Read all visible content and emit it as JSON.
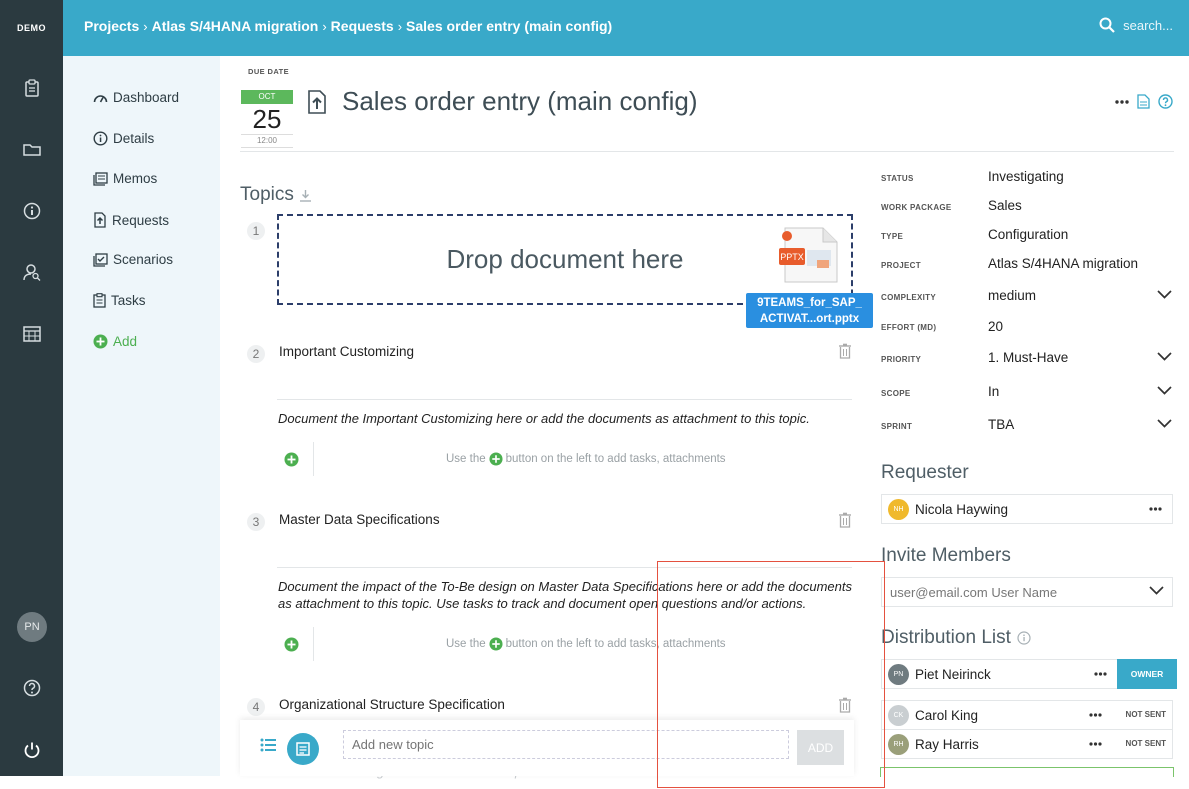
{
  "brand": "DEMO",
  "breadcrumbs": [
    "Projects",
    "Atlas S/4HANA migration",
    "Requests",
    "Sales order entry (main config)"
  ],
  "search_placeholder": "search...",
  "user_initials": "PN",
  "nav": [
    {
      "label": "Dashboard",
      "icon": "gauge-icon"
    },
    {
      "label": "Details",
      "icon": "info-icon"
    },
    {
      "label": "Memos",
      "icon": "memo-icon"
    },
    {
      "label": "Requests",
      "icon": "request-icon"
    },
    {
      "label": "Scenarios",
      "icon": "scenario-icon"
    },
    {
      "label": "Tasks",
      "icon": "clipboard-icon"
    },
    {
      "label": "Add",
      "icon": "plus-circle-icon"
    }
  ],
  "due": {
    "label": "DUE DATE",
    "month": "OCT",
    "day": "25",
    "time": "12:00"
  },
  "title": "Sales order entry (main config)",
  "topics": {
    "heading": "Topics",
    "dropzone_text": "Drop document here",
    "dragged_file": {
      "badge": "PPTX",
      "name_line1": "9TEAMS_for_SAP_",
      "name_line2": "ACTIVAT...ort.pptx"
    },
    "items": [
      {
        "num": "1"
      },
      {
        "num": "2",
        "title": "Important Customizing",
        "desc": "Document the Important Customizing here or add the documents as attachment to this topic."
      },
      {
        "num": "3",
        "title": "Master Data Specifications",
        "desc": "Document the impact of the To-Be design on Master Data Specifications here or add the documents as attachment to this topic. Use tasks to track and document open questions and/or actions."
      },
      {
        "num": "4",
        "title": "Organizational Structure Specification",
        "desc": "Document the Organizational Structure Specification here or add the documents as attachment to"
      }
    ],
    "hint_prefix": "Use the",
    "hint_suffix": "button on the left to add tasks, attachments"
  },
  "add_topic": {
    "placeholder": "Add new topic",
    "button": "ADD"
  },
  "meta": [
    {
      "label": "STATUS",
      "value": "Investigating",
      "dropdown": false
    },
    {
      "label": "WORK PACKAGE",
      "value": "Sales",
      "dropdown": false
    },
    {
      "label": "TYPE",
      "value": "Configuration",
      "dropdown": false
    },
    {
      "label": "PROJECT",
      "value": "Atlas S/4HANA migration",
      "dropdown": false
    },
    {
      "label": "COMPLEXITY",
      "value": "medium",
      "dropdown": true
    },
    {
      "label": "EFFORT (MD)",
      "value": "20",
      "dropdown": false
    },
    {
      "label": "PRIORITY",
      "value": "1. Must-Have",
      "dropdown": true
    },
    {
      "label": "SCOPE",
      "value": "In",
      "dropdown": true
    },
    {
      "label": "SPRINT",
      "value": "TBA",
      "dropdown": true
    }
  ],
  "requester": {
    "heading": "Requester",
    "initials": "NH",
    "name": "Nicola Haywing",
    "color": "#f0b92c"
  },
  "invite": {
    "heading": "Invite Members",
    "placeholder": "user@email.com User Name"
  },
  "distribution": {
    "heading": "Distribution List",
    "members": [
      {
        "initials": "PN",
        "name": "Piet Neirinck",
        "status": "OWNER",
        "color": "#6f7b80"
      },
      {
        "initials": "CK",
        "name": "Carol King",
        "status": "NOT SENT",
        "color": "#c9ced1"
      },
      {
        "initials": "RH",
        "name": "Ray Harris",
        "status": "NOT SENT",
        "color": "#9a9f7a"
      }
    ]
  }
}
